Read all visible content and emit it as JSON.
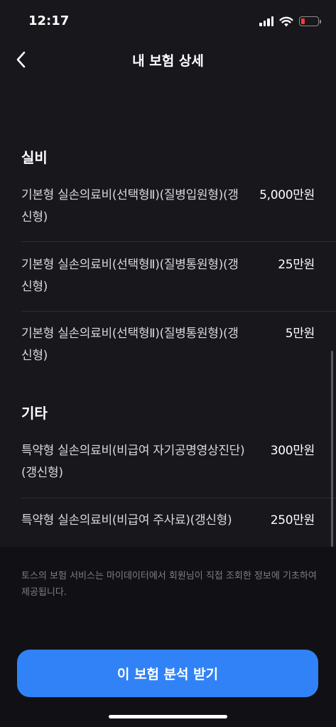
{
  "status_bar": {
    "time": "12:17"
  },
  "nav": {
    "title": "내 보험 상세"
  },
  "sections": [
    {
      "title": "실비",
      "items": [
        {
          "name": "기본형 실손의료비(선택형Ⅱ)(질병입원형)(갱신형)",
          "amount": "5,000만원"
        },
        {
          "name": "기본형 실손의료비(선택형Ⅱ)(질병통원형)(갱신형)",
          "amount": "25만원"
        },
        {
          "name": "기본형 실손의료비(선택형Ⅱ)(질병통원형)(갱신형)",
          "amount": "5만원"
        }
      ]
    },
    {
      "title": "기타",
      "items": [
        {
          "name": "특약형 실손의료비(비급여 자기공명영상진단)(갱신형)",
          "amount": "300만원"
        },
        {
          "name": "특약형 실손의료비(비급여 주사료)(갱신형)",
          "amount": "250만원"
        }
      ]
    }
  ],
  "footer": {
    "disclaimer": "토스의 보험 서비스는 마이데이터에서 회원님이 직접 조회한 정보에 기초하여 제공됩니다.",
    "cta_label": "이 보험 분석 받기"
  },
  "colors": {
    "background": "#17171c",
    "footer_background": "#111115",
    "accent": "#3182f6",
    "battery_low": "#ff3b30"
  }
}
